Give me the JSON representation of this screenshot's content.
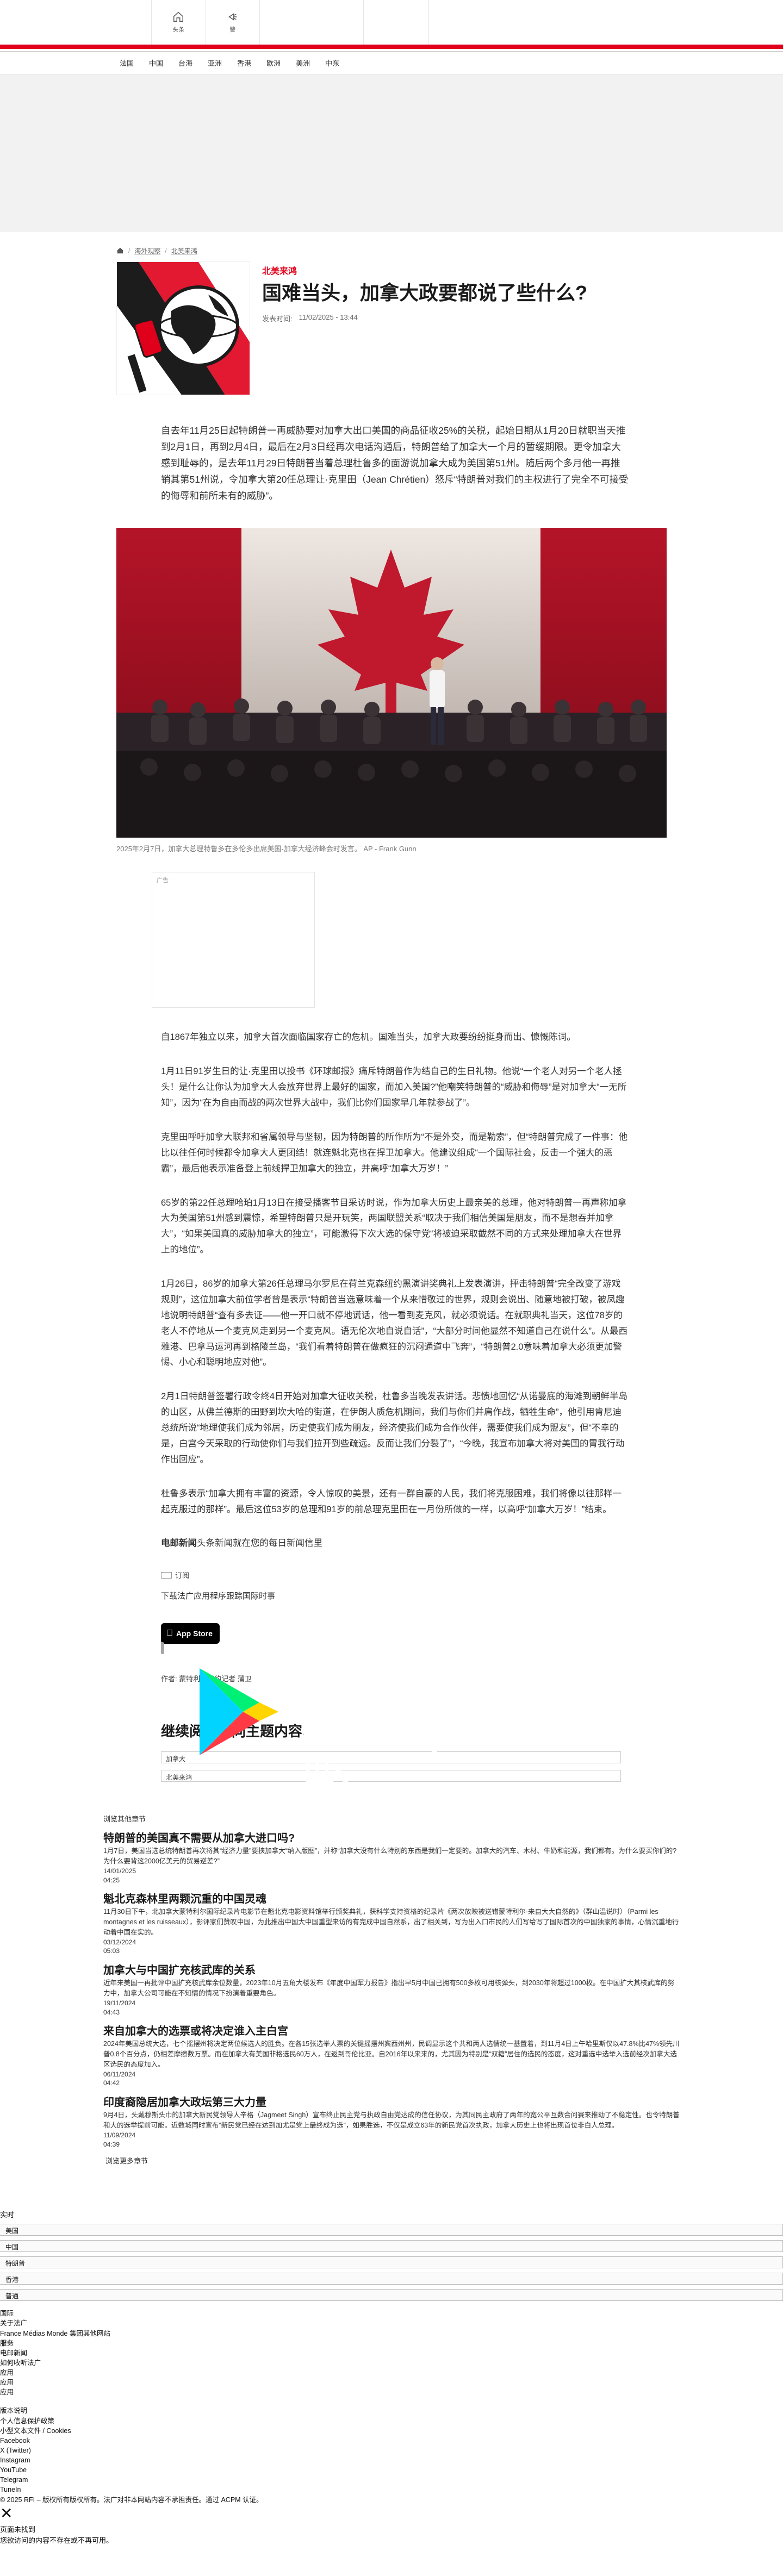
{
  "header": {
    "home_label": "头条",
    "alert_label": "警"
  },
  "regions": [
    "法国",
    "中国",
    "台海",
    "亚洲",
    "香港",
    "欧洲",
    "美洲",
    "中东"
  ],
  "breadcrumb": {
    "link1": "海外观察",
    "link2": "北美来鸿"
  },
  "article": {
    "kicker": "北美来鸿",
    "title": "国难当头，加拿大政要都说了些什么?",
    "published_label": "发表时间:",
    "published_value": "11/02/2025 - 13:44",
    "lead": "自去年11月25日起特朗普一再威胁要对加拿大出口美国的商品征收25%的关税，起始日期从1月20日就职当天推到2月1日，再到2月4日，最后在2月3日经再次电话沟通后，特朗普给了加拿大一个月的暂缓期限。更令加拿大感到耻辱的，是去年11月29日特朗普当着总理杜鲁多的面游说加拿大成为美国第51州。随后两个多月他一再推销其第51州说，令加拿大第20任总理让·克里田（Jean Chrétien）怒斥“特朗普对我们的主权进行了完全不可接受的侮辱和前所未有的威胁”。",
    "caption": "2025年2月7日，加拿大总理特鲁多在多伦多出席美国-加拿大经济峰会时发言。 AP - Frank Gunn",
    "ad_label": "广告",
    "paragraphs": [
      "自1867年独立以来，加拿大首次面临国家存亡的危机。国难当头，加拿大政要纷纷挺身而出、慷慨陈词。",
      "1月11日91岁生日的让·克里田以投书《环球邮报》痛斥特朗普作为结自己的生日礼物。他说“一个老人对另一个老人拯头！是什么让你认为加拿大人会放弃世界上最好的国家，而加入美国?”他嘲笑特朗普的“威胁和侮辱”是对加拿大“一无所知”，因为“在为自由而战的两次世界大战中，我们比你们国家早几年就参战了”。",
      "克里田呼吁加拿大联邦和省属领导与坚韧，因为特朗普的所作所为“不是外交，而是勒索”，但“特朗普完成了一件事：他比以往任何时候都令加拿大人更团结！就连魁北克也在捍卫加拿大。他建议组成“一个国际社会，反击一个强大的恶霸”，最后他表示准备登上前线捍卫加拿大的独立，并高呼“加拿大万岁！”",
      "65岁的第22任总理哈珀1月13日在接受播客节目采访时说，作为加拿大历史上最亲美的总理，他对特朗普一再声称加拿大为美国第51州感到震惊，希望特朗普只是开玩笑，两国联盟关系“取决于我们相信美国是朋友，而不是想吞并加拿大”，“如果美国真的威胁加拿大的独立”，可能激得下次大选的保守党“将被迫采取截然不同的方式来处理加拿大在世界上的地位”。",
      "1月26日，86岁的加拿大第26任总理马尔罗尼在荷兰克森纽约黑演讲奖典礼上发表演讲，抨击特朗普“完全改变了游戏规则”，这位加拿大前位学者曾是表示“特朗普当选意味着一个从来惜敬过的世界，规则会说出、随意地被打破，被凤趣地说明特朗普“查有多去证——他一开口就不停地谎话，他一看到麦克风，就必须说话。在就职典礼当天，这位78岁的老人不停地从一个麦克风走到另一个麦克风。语无伦次地自说自话”，“大部分时间他显然不知道自己在说什么”。从最西雅港、巴拿马运河再到格陵兰岛，“我们看着特朗普在做疯狂的沉闷通道中飞奔”，“特朗普2.0意味着加拿大必须更加警惕、小心和聪明地应对他”。",
      "2月1日特朗普签署行政令终4日开始对加拿大征收关税，杜鲁多当晚发表讲话。悲愤地回忆“从诺曼底的海滩到朝鲜半岛的山区，从佛兰德斯的田野到坎大哈的街道，在伊朗人质危机期间，我们与你们并肩作战，牺牲生命”，他引用肯尼迪总统所说“地理使我们成为邻居，历史使我们成为朋友，经济使我们成为合作伙伴，需要使我们成为盟友”，但“不幸的是，白宫今天采取的行动使你们与我们拉开到些疏远。反而让我们分裂了”，“今晚，我宣布加拿大将对美国的胃我行动作出回应”。",
      "杜鲁多表示“加拿大拥有丰富的资源，令人惊叹的美景，还有一群自豪的人民，我们将克服困难，我们将像以往那样一起克服过的那样”。最后这位53岁的总理和91岁的前总理克里田在一月份所做的一样，以高呼“加拿大万岁！”结束。"
    ],
    "newsletter_strong": "电邮新闻",
    "newsletter_rest": "头条新闻就在您的每日新闻信里",
    "subscribe_label": "订阅",
    "download_text": "下载法广应用程序跟踪国际时事",
    "app_store_label": "App Store",
    "gplay_top": "下载应用，请到",
    "gplay_brand": "Google Play",
    "author_line": "作者: 蒙特利尔特约记者 蒲卫"
  },
  "continue": {
    "title": "继续阅读相同主题内容:",
    "tags": [
      "加拿大",
      "北美来鸿"
    ]
  },
  "related": {
    "label": "浏览其他章节",
    "items": [
      {
        "title": "特朗普的美国真不需要从加拿大进口吗?",
        "desc": "1月7日，美国当选总统特朗普再次将其“经济力量”要挟加拿大“纳入版图”，并称“加拿大没有什么特别的东西是我们一定要的。加拿大的汽车、木材、牛奶和能源，我们都有。为什么要买你们的?为什么要背这2000亿美元的贸易逆差?”",
        "date": "14/01/2025",
        "time": "04:25"
      },
      {
        "title": "魁北克森林里两颗沉重的中国灵魂",
        "desc": "11月30日下午，北加拿大蒙特利尔国际纪录片电影节在魁北克电影资料馆举行颁奖典礼，获科学支持资格的纪录片《两次放映被送错蒙特利尔·来自大大自然的》（群山温说时）（Parmi les montagnes et les ruisseaux），影评家们赞叹中国，为此推出中国大中国重型来访的有完成中国自然系，出了相关到，写为出入口市民的人们写给写了国际首次的中国独家的事情，心情沉重地行动着中国在实的。",
        "date": "03/12/2024",
        "time": "05:03"
      },
      {
        "title": "加拿大与中国扩充核武库的关系",
        "desc": "近年来美国一再批评中国扩充核武库余位数量，2023年10月五角大楼发布《年度中国军力报告》指出早5月中国已拥有500多枚可用核弹头，到2030年将超过1000枚。在中国扩大其核武库的努力中，加拿大公司可能在不知情的情况下扮演着重要角色。",
        "date": "19/11/2024",
        "time": "04:43"
      },
      {
        "title": "来自加拿大的选票或将决定谁入主白宫",
        "desc": "2024年美国总统大选，七个摇摆州将决定两位候选人的胜负。在各15张选举人票的关键摇摆州宾西州州，民调显示这个共和两人选情统一基置着，到11月4日上午哈里斯仅以47.8%比47%领先川普0.8个百分点，仍相差摩擦数万票。而在加拿大有美国非格选民60万人，在返到哥伦比亚。自2016年以来来的，尤其因为特别是“双籍”居住的选民的态度，这对重选中选举入选前经次加拿大选区选民的态度加入。",
        "date": "06/11/2024",
        "time": "04:42"
      },
      {
        "title": "印度裔隐居加拿大政坛第三大力量",
        "desc": "9月4日，头戴穆斯头巾的加拿大新民党领导人辛格（Jagmeet Singh）宣布终止民主党与执政自由党达成的信任协议，为其同民主政府了两年的宽公平互数合问赛来推动了不稳定性。也令特朗普和大的选举提前可能。近数城同时宣布“新民党已经在达到加尤是党上最终成为选”，如果胜选，不仅是成立63年的新民党首次执政，加拿大历史上也将出现首位非白人总理。",
        "date": "11/09/2024",
        "time": "04:39"
      }
    ],
    "more": "浏览更多章节"
  },
  "language": {
    "label": "实时",
    "options": [
      "美国",
      "中国",
      "特朗普",
      "香港",
      "普通"
    ]
  },
  "footer": {
    "links_a": [
      "国际",
      "关于法广",
      "France Médias Monde 集团其他网站",
      "服务",
      "电邮新闻",
      "如何收听法广",
      "应用",
      "应用",
      "应用"
    ],
    "links_b": [
      "版本说明",
      "个人信息保护政策",
      "小型文本文件 / Cookies",
      "Facebook",
      "X (Twitter)",
      "Instagram",
      "YouTube",
      "Telegram",
      "TuneIn"
    ],
    "copyright": "© 2025 RFI – 版权所有版权所有。法广对非本网站内容不承担责任。通过 ACPM 认证。",
    "not_found_title": "页面未找到",
    "not_found_desc": "您欲访问的内容不存在或不再可用。"
  }
}
